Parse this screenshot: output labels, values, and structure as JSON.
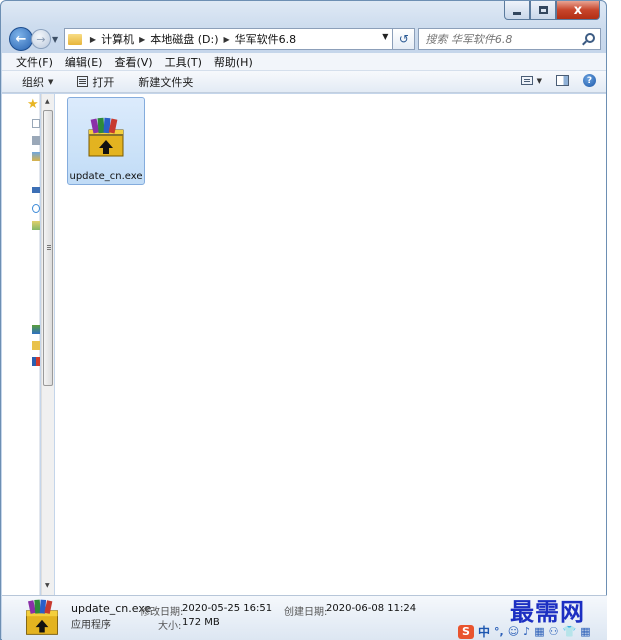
{
  "window": {
    "caption_buttons": {
      "minimize": "minimize",
      "maximize": "maximize",
      "close": "x"
    }
  },
  "address": {
    "breadcrumbs": [
      "计算机",
      "本地磁盘 (D:)",
      "华军软件6.8"
    ],
    "search_placeholder": "搜索 华军软件6.8"
  },
  "menu": {
    "items": [
      "文件(F)",
      "编辑(E)",
      "查看(V)",
      "工具(T)",
      "帮助(H)"
    ]
  },
  "toolbar": {
    "organize": "组织",
    "open": "打开",
    "new_folder": "新建文件夹"
  },
  "files": [
    {
      "name": "update_cn.exe",
      "icon": "winrar-installer-icon",
      "selected": true
    }
  ],
  "details": {
    "name": "update_cn.exe",
    "type": "应用程序",
    "modified_label": "修改日期:",
    "modified_value": "2020-05-25 16:51",
    "size_label": "大小:",
    "size_value": "172 MB",
    "created_label": "创建日期:",
    "created_value": "2020-06-08 11:24"
  },
  "watermark": "最需网",
  "ime": {
    "logo": "S",
    "mode": "中",
    "glyphs": [
      "°,",
      "☺",
      "♪",
      "▦",
      "⚇",
      "👕",
      "▦"
    ]
  },
  "colors": {
    "frame": "#c4d5ea",
    "selection": "#c1dcf6",
    "watermark": "#1c2fc2",
    "close_button": "#c7452b"
  }
}
